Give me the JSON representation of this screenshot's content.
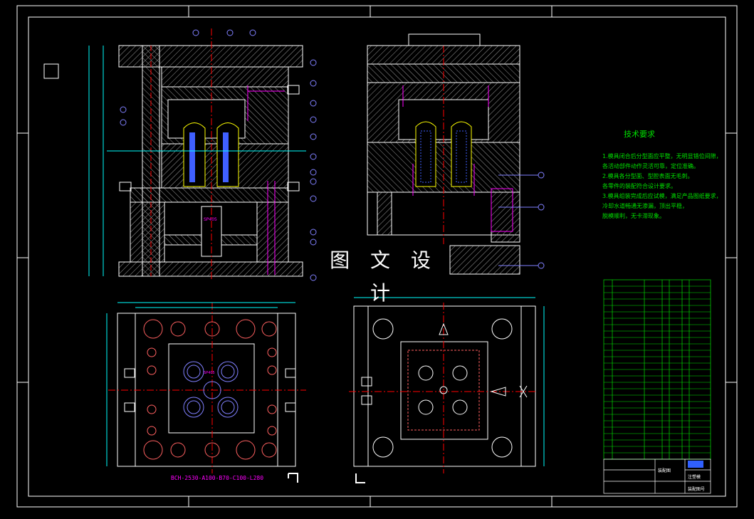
{
  "watermark": "图 文 设 计",
  "tech_requirements": {
    "title": "技术要求",
    "lines": [
      "1.模具闭合后分型面应平整，无明显错位间隙，",
      "  各活动部件动作灵活可靠，定位准确。",
      "2.模具各分型面、型腔表面无毛刺。",
      "  各零件的装配符合设计要求。",
      "3.模具组装完成后应试模，满足产品图纸要求，",
      "  冷却水道畅通无渗漏，顶出平稳，",
      "  脱模顺利，无卡滞现象。"
    ]
  },
  "mold_base_label": "BCH-2530-A100-B70-C100-L280",
  "part_label_1": "SP405",
  "part_label_2": "SP405",
  "title_block": {
    "drawing_name": "装配图",
    "school": "注塑模",
    "drawing_no": "装配图号"
  },
  "colors": {
    "frame": "#ffffff",
    "dimension": "#00ffff",
    "hatch": "#b0b0b0",
    "centerline": "#ff0000",
    "balloon": "#8080ff",
    "text_green": "#00e000",
    "magenta": "#ff00ff",
    "yellow": "#ffff00"
  }
}
